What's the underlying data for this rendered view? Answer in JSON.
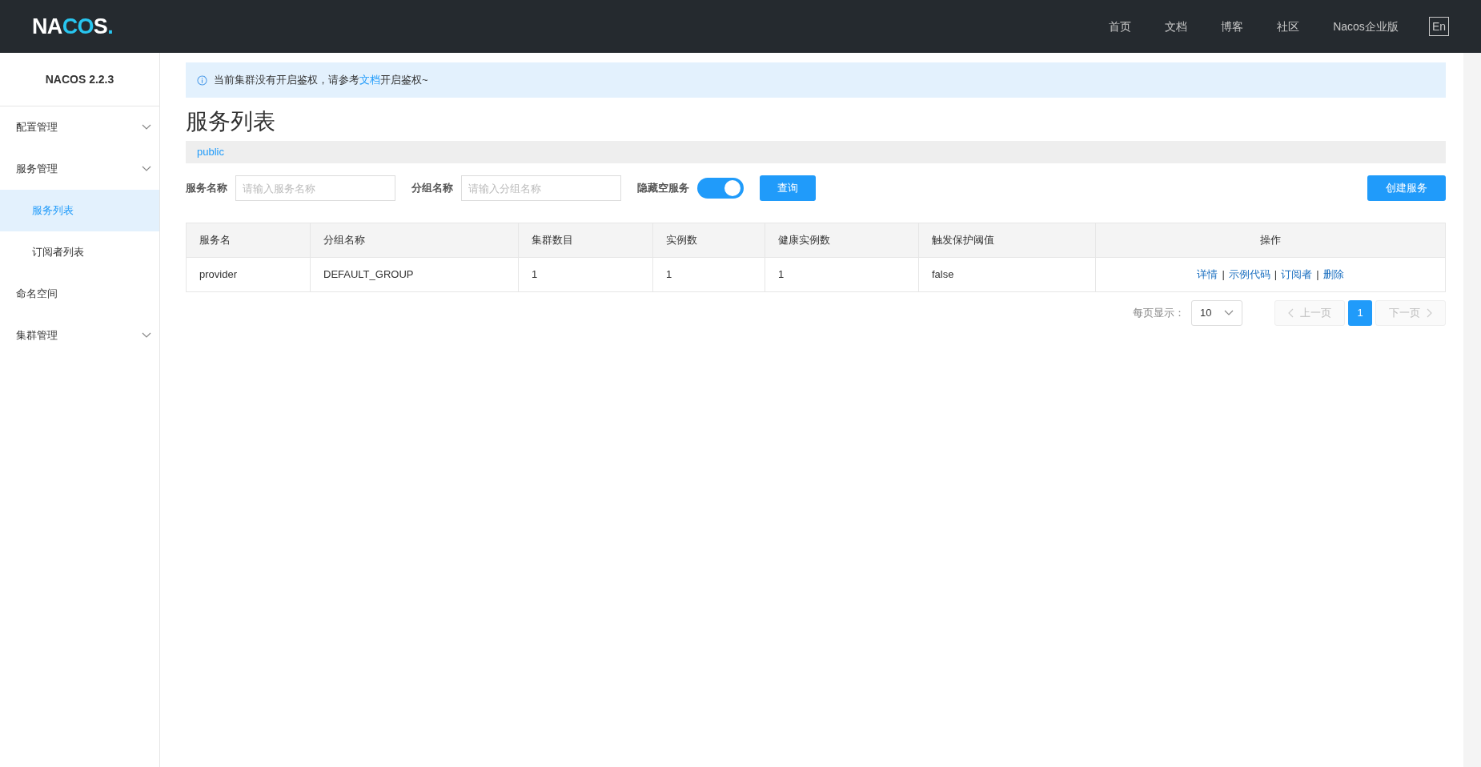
{
  "header": {
    "logo": "NACOS.",
    "nav": [
      "首页",
      "文档",
      "博客",
      "社区",
      "Nacos企业版"
    ],
    "language_button": "En"
  },
  "sidebar": {
    "version": "NACOS 2.2.3",
    "items": [
      {
        "label": "配置管理",
        "has_submenu": true,
        "selected": false
      },
      {
        "label": "服务管理",
        "has_submenu": true,
        "selected": false,
        "children": [
          {
            "label": "服务列表",
            "selected": true
          },
          {
            "label": "订阅者列表",
            "selected": false
          }
        ]
      },
      {
        "label": "命名空间",
        "has_submenu": false,
        "selected": false
      },
      {
        "label": "集群管理",
        "has_submenu": true,
        "selected": false
      }
    ]
  },
  "notice": {
    "text_before": "当前集群没有开启鉴权，请参考",
    "link": "文档",
    "text_after": "开启鉴权~"
  },
  "page_title": "服务列表",
  "namespaces": [
    {
      "label": "public",
      "selected": true
    }
  ],
  "filters": {
    "service_name": {
      "label": "服务名称",
      "placeholder": "请输入服务名称"
    },
    "group_name": {
      "label": "分组名称",
      "placeholder": "请输入分组名称"
    },
    "hide_empty": {
      "label": "隐藏空服务",
      "on": true
    },
    "query_button": "查询",
    "create_button": "创建服务"
  },
  "table": {
    "columns": [
      "服务名",
      "分组名称",
      "集群数目",
      "实例数",
      "健康实例数",
      "触发保护阈值",
      "操作"
    ],
    "rows": [
      {
        "cells": [
          "provider",
          "DEFAULT_GROUP",
          "1",
          "1",
          "1",
          "false"
        ],
        "actions": [
          "详情",
          "示例代码",
          "订阅者",
          "删除"
        ],
        "separators": [
          "|",
          "|",
          "|"
        ]
      }
    ]
  },
  "pagination": {
    "page_size_label": "每页显示：",
    "page_size": "10",
    "prev": "上一页",
    "next": "下一页",
    "pages": [
      {
        "label": "1",
        "selected": true
      }
    ]
  }
}
